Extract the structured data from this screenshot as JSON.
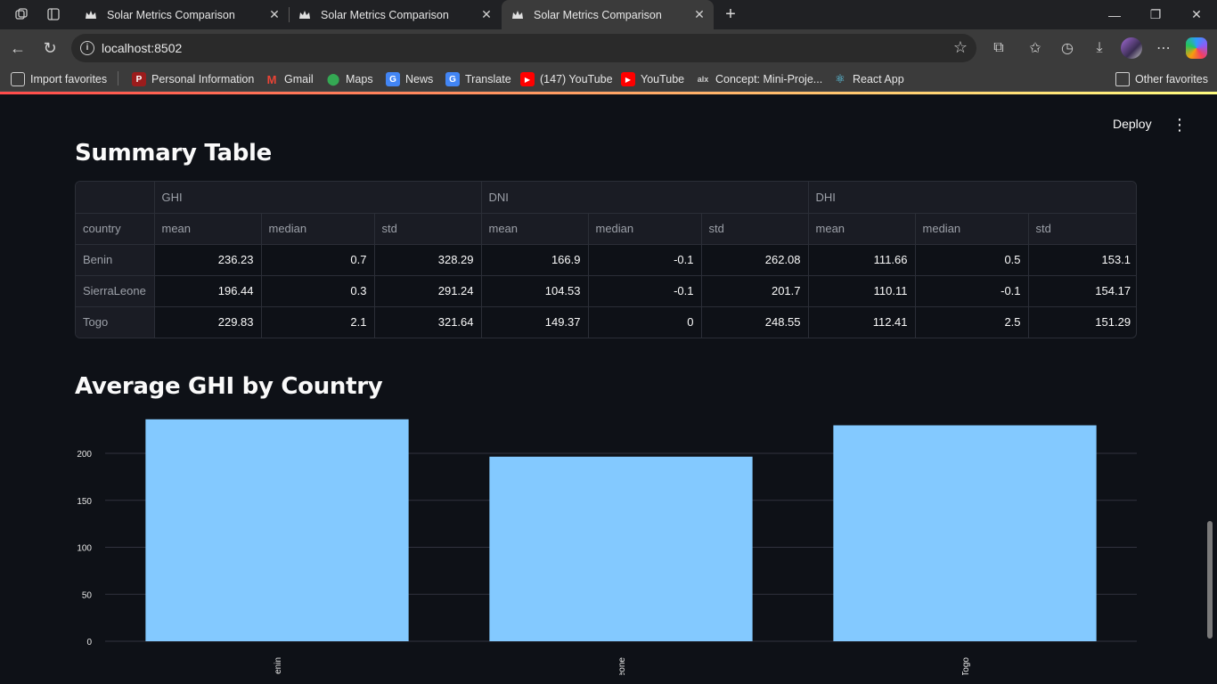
{
  "browser": {
    "tabs": [
      {
        "title": "Solar Metrics Comparison"
      },
      {
        "title": "Solar Metrics Comparison"
      },
      {
        "title": "Solar Metrics Comparison"
      }
    ],
    "url": "localhost:8502",
    "bookmarks": [
      {
        "label": "Import favorites",
        "icon": "import-icon"
      },
      {
        "label": "Personal Information",
        "icon": "shield-icon"
      },
      {
        "label": "Gmail",
        "icon": "gmail-icon"
      },
      {
        "label": "Maps",
        "icon": "maps-pin-icon"
      },
      {
        "label": "News",
        "icon": "news-icon"
      },
      {
        "label": "Translate",
        "icon": "translate-icon"
      },
      {
        "label": "(147) YouTube",
        "icon": "youtube-icon"
      },
      {
        "label": "YouTube",
        "icon": "youtube-icon"
      },
      {
        "label": "Concept: Mini-Proje...",
        "icon": "alx-icon"
      },
      {
        "label": "React App",
        "icon": "react-icon"
      }
    ],
    "other_favorites": "Other favorites"
  },
  "app": {
    "deploy_label": "Deploy",
    "summary_title": "Summary Table",
    "chart_title": "Average GHI by Country"
  },
  "table": {
    "groups": [
      "GHI",
      "DNI",
      "DHI"
    ],
    "index_name": "country",
    "sub_headers": [
      "mean",
      "median",
      "std",
      "mean",
      "median",
      "std",
      "mean",
      "median",
      "std"
    ],
    "rows": [
      {
        "country": "Benin",
        "values": [
          "236.23",
          "0.7",
          "328.29",
          "166.9",
          "-0.1",
          "262.08",
          "111.66",
          "0.5",
          "153.1"
        ]
      },
      {
        "country": "SierraLeone",
        "values": [
          "196.44",
          "0.3",
          "291.24",
          "104.53",
          "-0.1",
          "201.7",
          "110.11",
          "-0.1",
          "154.17"
        ]
      },
      {
        "country": "Togo",
        "values": [
          "229.83",
          "2.1",
          "321.64",
          "149.37",
          "0",
          "248.55",
          "112.41",
          "2.5",
          "151.29"
        ]
      }
    ]
  },
  "chart_data": {
    "type": "bar",
    "categories": [
      "Benin",
      "SierraLeone",
      "Togo"
    ],
    "values": [
      236.23,
      196.44,
      229.83
    ],
    "visible_tick_labels": [
      "enin",
      "eone",
      "Togo"
    ],
    "yticks": [
      0,
      50,
      100,
      150,
      200
    ],
    "ylim": [
      0,
      250
    ],
    "color": "#83c9ff",
    "grid": true
  }
}
